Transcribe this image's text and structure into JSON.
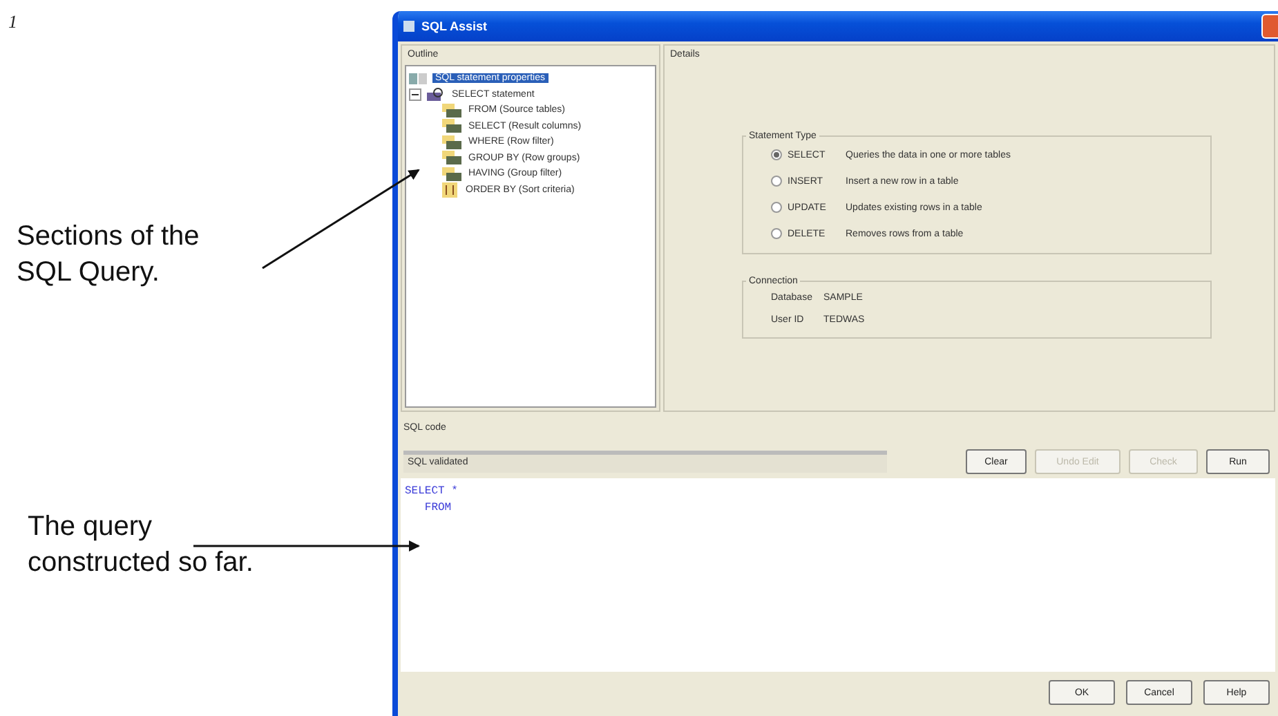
{
  "page_number": "1",
  "annotations": [
    {
      "text": "Sections of the\nSQL Query."
    },
    {
      "text": "The query\nconstructed so far."
    }
  ],
  "window": {
    "title": "SQL Assist"
  },
  "outline": {
    "label": "Outline",
    "tree": [
      {
        "label": "SQL statement properties",
        "kind": "properties",
        "selected": true
      },
      {
        "label": "SELECT statement",
        "kind": "statement",
        "selected": false,
        "expanded": true,
        "children": [
          {
            "label": "FROM (Source tables)",
            "kind": "clause",
            "selected": false
          },
          {
            "label": "SELECT (Result columns)",
            "kind": "clause",
            "selected": false
          },
          {
            "label": "WHERE (Row filter)",
            "kind": "clause",
            "selected": false
          },
          {
            "label": "GROUP BY (Row groups)",
            "kind": "clause",
            "selected": false
          },
          {
            "label": "HAVING (Group filter)",
            "kind": "clause",
            "selected": false
          },
          {
            "label": "ORDER BY (Sort criteria)",
            "kind": "sort",
            "selected": false
          }
        ]
      }
    ]
  },
  "details": {
    "label": "Details",
    "statement_type": {
      "label": "Statement Type",
      "options": [
        {
          "label": "SELECT",
          "description": "Queries the data in one or more tables",
          "selected": true
        },
        {
          "label": "INSERT",
          "description": "Insert a new row in a table",
          "selected": false
        },
        {
          "label": "UPDATE",
          "description": "Updates existing rows in a table",
          "selected": false
        },
        {
          "label": "DELETE",
          "description": "Removes rows from a table",
          "selected": false
        }
      ]
    },
    "connection": {
      "label": "Connection",
      "fields": [
        {
          "label": "Database",
          "value": "SAMPLE"
        },
        {
          "label": "User ID",
          "value": "TEDWAS"
        }
      ]
    }
  },
  "sql_code": {
    "label": "SQL code",
    "status": "SQL validated",
    "buttons": [
      {
        "label": "Clear",
        "disabled": false
      },
      {
        "label": "Undo Edit",
        "disabled": true
      },
      {
        "label": "Check",
        "disabled": true
      },
      {
        "label": "Run",
        "disabled": false
      }
    ],
    "lines": [
      "SELECT *",
      "   FROM"
    ]
  },
  "footer_buttons": [
    {
      "label": "OK"
    },
    {
      "label": "Cancel"
    },
    {
      "label": "Help"
    }
  ]
}
